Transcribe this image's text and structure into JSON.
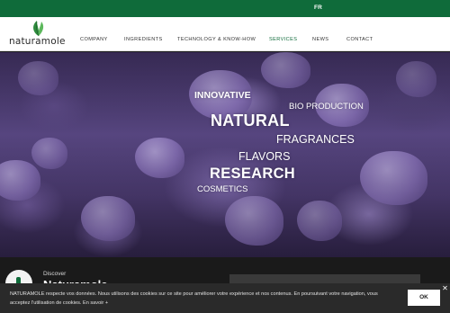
{
  "topbar": {
    "language": "FR",
    "color": "#0f6b3a"
  },
  "header": {
    "logo_text": "naturamole",
    "nav": [
      {
        "label": "COMPANY"
      },
      {
        "label": "INGREDIENTS"
      },
      {
        "label": "TECHNOLOGY & KNOW-HOW"
      },
      {
        "label": "SERVICES",
        "active": true
      },
      {
        "label": "NEWS"
      },
      {
        "label": "CONTACT"
      }
    ]
  },
  "hero": {
    "words": {
      "innovative": "INNOVATIVE",
      "bio_production": "BIO PRODUCTION",
      "natural": "NATURAL",
      "fragrances": "FRAGRANCES",
      "flavors": "FLAVORS",
      "research": "RESEARCH",
      "cosmetics": "COSMETICS"
    }
  },
  "discover": {
    "label": "Discover",
    "title": "Naturamole"
  },
  "cookie_banner": {
    "text": "NATURAMOLE respecte vos données. Nous utilisons des cookies sur ce site pour améliorer votre expérience et nos contenus. En poursuivant votre navigation, vous acceptez l'utilisation de cookies. En savoir +",
    "ok_label": "OK",
    "close_icon": "close-icon"
  }
}
